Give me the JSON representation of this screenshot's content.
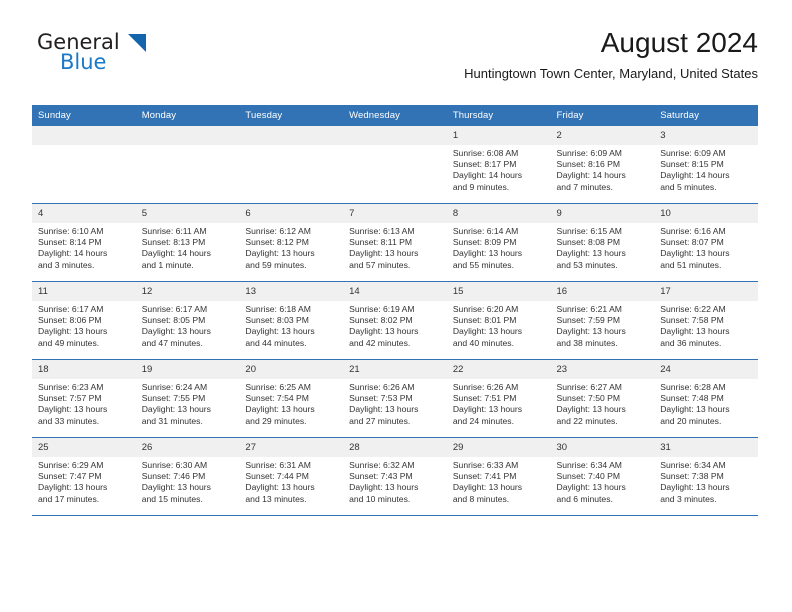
{
  "brand": {
    "word_top": "General",
    "word_bottom": "Blue",
    "triangle_color": "#1565ad",
    "blue_text_color": "#1a79c9"
  },
  "header": {
    "title": "August 2024",
    "subtitle": "Huntingtown Town Center, Maryland, United States"
  },
  "theme": {
    "header_blue": "#3273b5",
    "daynum_band": "#f0f0f0",
    "text": "#333333"
  },
  "calendar": {
    "weekday_headers": [
      "Sunday",
      "Monday",
      "Tuesday",
      "Wednesday",
      "Thursday",
      "Friday",
      "Saturday"
    ],
    "weeks": [
      [
        {
          "day": "",
          "lines": []
        },
        {
          "day": "",
          "lines": []
        },
        {
          "day": "",
          "lines": []
        },
        {
          "day": "",
          "lines": []
        },
        {
          "day": "1",
          "lines": [
            "Sunrise: 6:08 AM",
            "Sunset: 8:17 PM",
            "Daylight: 14 hours",
            "and 9 minutes."
          ]
        },
        {
          "day": "2",
          "lines": [
            "Sunrise: 6:09 AM",
            "Sunset: 8:16 PM",
            "Daylight: 14 hours",
            "and 7 minutes."
          ]
        },
        {
          "day": "3",
          "lines": [
            "Sunrise: 6:09 AM",
            "Sunset: 8:15 PM",
            "Daylight: 14 hours",
            "and 5 minutes."
          ]
        }
      ],
      [
        {
          "day": "4",
          "lines": [
            "Sunrise: 6:10 AM",
            "Sunset: 8:14 PM",
            "Daylight: 14 hours",
            "and 3 minutes."
          ]
        },
        {
          "day": "5",
          "lines": [
            "Sunrise: 6:11 AM",
            "Sunset: 8:13 PM",
            "Daylight: 14 hours",
            "and 1 minute."
          ]
        },
        {
          "day": "6",
          "lines": [
            "Sunrise: 6:12 AM",
            "Sunset: 8:12 PM",
            "Daylight: 13 hours",
            "and 59 minutes."
          ]
        },
        {
          "day": "7",
          "lines": [
            "Sunrise: 6:13 AM",
            "Sunset: 8:11 PM",
            "Daylight: 13 hours",
            "and 57 minutes."
          ]
        },
        {
          "day": "8",
          "lines": [
            "Sunrise: 6:14 AM",
            "Sunset: 8:09 PM",
            "Daylight: 13 hours",
            "and 55 minutes."
          ]
        },
        {
          "day": "9",
          "lines": [
            "Sunrise: 6:15 AM",
            "Sunset: 8:08 PM",
            "Daylight: 13 hours",
            "and 53 minutes."
          ]
        },
        {
          "day": "10",
          "lines": [
            "Sunrise: 6:16 AM",
            "Sunset: 8:07 PM",
            "Daylight: 13 hours",
            "and 51 minutes."
          ]
        }
      ],
      [
        {
          "day": "11",
          "lines": [
            "Sunrise: 6:17 AM",
            "Sunset: 8:06 PM",
            "Daylight: 13 hours",
            "and 49 minutes."
          ]
        },
        {
          "day": "12",
          "lines": [
            "Sunrise: 6:17 AM",
            "Sunset: 8:05 PM",
            "Daylight: 13 hours",
            "and 47 minutes."
          ]
        },
        {
          "day": "13",
          "lines": [
            "Sunrise: 6:18 AM",
            "Sunset: 8:03 PM",
            "Daylight: 13 hours",
            "and 44 minutes."
          ]
        },
        {
          "day": "14",
          "lines": [
            "Sunrise: 6:19 AM",
            "Sunset: 8:02 PM",
            "Daylight: 13 hours",
            "and 42 minutes."
          ]
        },
        {
          "day": "15",
          "lines": [
            "Sunrise: 6:20 AM",
            "Sunset: 8:01 PM",
            "Daylight: 13 hours",
            "and 40 minutes."
          ]
        },
        {
          "day": "16",
          "lines": [
            "Sunrise: 6:21 AM",
            "Sunset: 7:59 PM",
            "Daylight: 13 hours",
            "and 38 minutes."
          ]
        },
        {
          "day": "17",
          "lines": [
            "Sunrise: 6:22 AM",
            "Sunset: 7:58 PM",
            "Daylight: 13 hours",
            "and 36 minutes."
          ]
        }
      ],
      [
        {
          "day": "18",
          "lines": [
            "Sunrise: 6:23 AM",
            "Sunset: 7:57 PM",
            "Daylight: 13 hours",
            "and 33 minutes."
          ]
        },
        {
          "day": "19",
          "lines": [
            "Sunrise: 6:24 AM",
            "Sunset: 7:55 PM",
            "Daylight: 13 hours",
            "and 31 minutes."
          ]
        },
        {
          "day": "20",
          "lines": [
            "Sunrise: 6:25 AM",
            "Sunset: 7:54 PM",
            "Daylight: 13 hours",
            "and 29 minutes."
          ]
        },
        {
          "day": "21",
          "lines": [
            "Sunrise: 6:26 AM",
            "Sunset: 7:53 PM",
            "Daylight: 13 hours",
            "and 27 minutes."
          ]
        },
        {
          "day": "22",
          "lines": [
            "Sunrise: 6:26 AM",
            "Sunset: 7:51 PM",
            "Daylight: 13 hours",
            "and 24 minutes."
          ]
        },
        {
          "day": "23",
          "lines": [
            "Sunrise: 6:27 AM",
            "Sunset: 7:50 PM",
            "Daylight: 13 hours",
            "and 22 minutes."
          ]
        },
        {
          "day": "24",
          "lines": [
            "Sunrise: 6:28 AM",
            "Sunset: 7:48 PM",
            "Daylight: 13 hours",
            "and 20 minutes."
          ]
        }
      ],
      [
        {
          "day": "25",
          "lines": [
            "Sunrise: 6:29 AM",
            "Sunset: 7:47 PM",
            "Daylight: 13 hours",
            "and 17 minutes."
          ]
        },
        {
          "day": "26",
          "lines": [
            "Sunrise: 6:30 AM",
            "Sunset: 7:46 PM",
            "Daylight: 13 hours",
            "and 15 minutes."
          ]
        },
        {
          "day": "27",
          "lines": [
            "Sunrise: 6:31 AM",
            "Sunset: 7:44 PM",
            "Daylight: 13 hours",
            "and 13 minutes."
          ]
        },
        {
          "day": "28",
          "lines": [
            "Sunrise: 6:32 AM",
            "Sunset: 7:43 PM",
            "Daylight: 13 hours",
            "and 10 minutes."
          ]
        },
        {
          "day": "29",
          "lines": [
            "Sunrise: 6:33 AM",
            "Sunset: 7:41 PM",
            "Daylight: 13 hours",
            "and 8 minutes."
          ]
        },
        {
          "day": "30",
          "lines": [
            "Sunrise: 6:34 AM",
            "Sunset: 7:40 PM",
            "Daylight: 13 hours",
            "and 6 minutes."
          ]
        },
        {
          "day": "31",
          "lines": [
            "Sunrise: 6:34 AM",
            "Sunset: 7:38 PM",
            "Daylight: 13 hours",
            "and 3 minutes."
          ]
        }
      ]
    ]
  }
}
